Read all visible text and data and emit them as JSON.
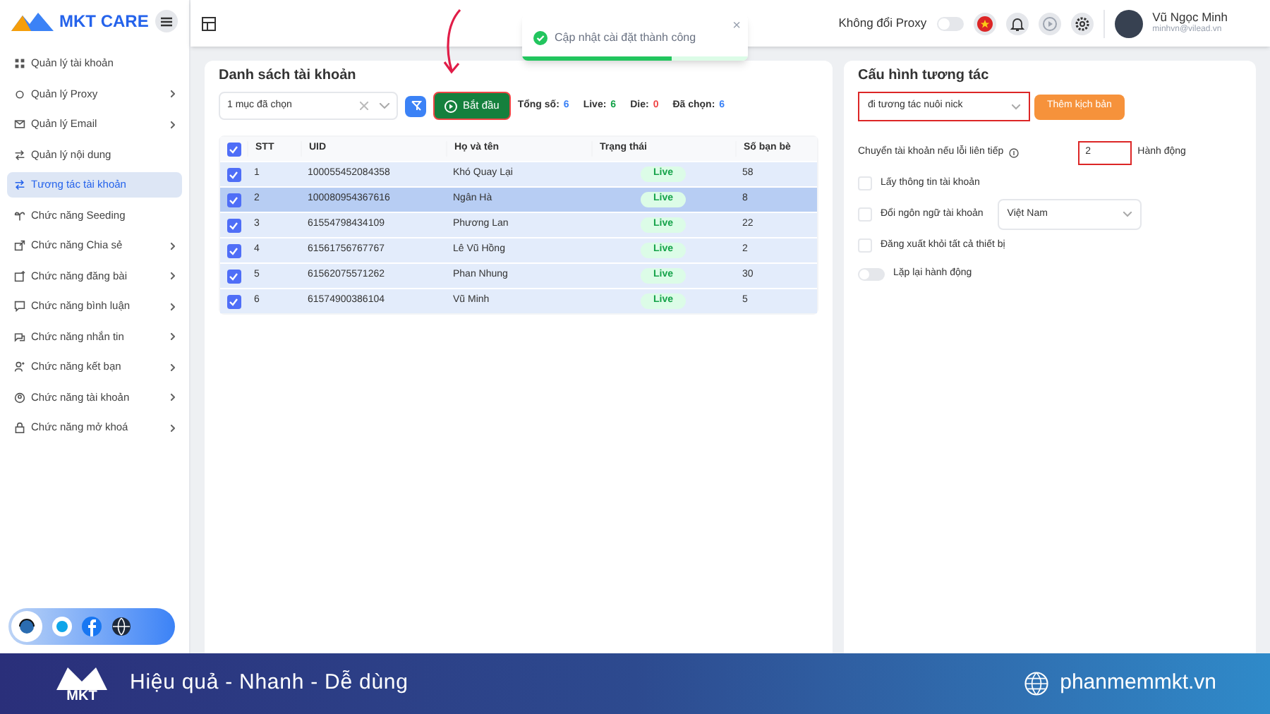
{
  "sidebar": {
    "logo": "MKT CARE",
    "items": [
      {
        "label": "Quản lý tài khoản",
        "selected": false,
        "expandable": false
      },
      {
        "label": "Quản lý Proxy",
        "selected": false,
        "expandable": true
      },
      {
        "label": "Quản lý Email",
        "selected": false,
        "expandable": true
      },
      {
        "label": "Quản lý nội dung",
        "selected": false,
        "expandable": false
      },
      {
        "label": "Tương tác tài khoản",
        "selected": true,
        "expandable": false
      },
      {
        "label": "Chức năng Seeding",
        "selected": false,
        "expandable": false
      },
      {
        "label": "Chức năng Chia sẻ",
        "selected": false,
        "expandable": true
      },
      {
        "label": "Chức năng đăng bài",
        "selected": false,
        "expandable": true
      },
      {
        "label": "Chức năng bình luận",
        "selected": false,
        "expandable": true
      },
      {
        "label": "Chức năng nhắn tin",
        "selected": false,
        "expandable": true
      },
      {
        "label": "Chức năng kết bạn",
        "selected": false,
        "expandable": true
      },
      {
        "label": "Chức năng tài khoản",
        "selected": false,
        "expandable": true
      },
      {
        "label": "Chức năng mở khoá",
        "selected": false,
        "expandable": true
      }
    ]
  },
  "topbar": {
    "proxy_label": "Không đổi Proxy",
    "proxy_on": false,
    "user_name": "Vũ Ngọc Minh",
    "user_email": "minhvn@vilead.vn"
  },
  "toast": {
    "message": "Cập nhật cài đặt thành công",
    "close": "×",
    "level": 0.66
  },
  "accounts": {
    "title": "Danh sách tài khoản",
    "filter_value": "1 mục đã chọn",
    "start_button": "Bắt đầu",
    "start_highlighted": true,
    "stats": [
      {
        "label": "Tổng số:",
        "value": "6",
        "color": "#3b82f6"
      },
      {
        "label": "Live:",
        "value": "6",
        "color": "#16a34a"
      },
      {
        "label": "Die:",
        "value": "0",
        "color": "#ef4444"
      },
      {
        "label": "Đã chọn:",
        "value": "6",
        "color": "#3b82f6"
      }
    ],
    "columns": [
      "STT",
      "UID",
      "Họ và tên",
      "Trạng thái",
      "Số bạn bè"
    ],
    "all_checked": true,
    "rows": [
      {
        "stt": "1",
        "uid": "100055452084358",
        "name": "Khó Quay Lại",
        "status": "Live",
        "friends": "58",
        "checked": true,
        "selected": false
      },
      {
        "stt": "2",
        "uid": "100080954367616",
        "name": "Ngân Hà",
        "status": "Live",
        "friends": "8",
        "checked": true,
        "selected": true
      },
      {
        "stt": "3",
        "uid": "61554798434109",
        "name": "Phương Lan",
        "status": "Live",
        "friends": "22",
        "checked": true,
        "selected": false
      },
      {
        "stt": "4",
        "uid": "61561756767767",
        "name": "Lê Vũ Hồng",
        "status": "Live",
        "friends": "2",
        "checked": true,
        "selected": false
      },
      {
        "stt": "5",
        "uid": "61562075571262",
        "name": "Phan Nhung",
        "status": "Live",
        "friends": "30",
        "checked": true,
        "selected": false
      },
      {
        "stt": "6",
        "uid": "61574900386104",
        "name": "Vũ Minh",
        "status": "Live",
        "friends": "5",
        "checked": true,
        "selected": false
      }
    ]
  },
  "config": {
    "title": "Cấu hình tương tác",
    "scenario": "đi tương tác nuôi nick",
    "scenario_highlighted": true,
    "add_button": "Thêm kịch bản",
    "switch_label": "Chuyển tài khoản nếu lỗi liên tiếp",
    "switch_value": "2",
    "switch_unit": "Hành động",
    "value_highlighted": true,
    "options": [
      {
        "kind": "checkbox",
        "label": "Lấy thông tin tài khoản",
        "checked": false
      },
      {
        "kind": "select",
        "label": "Đổi ngôn ngữ tài khoản",
        "checked": false,
        "value": "Việt Nam"
      },
      {
        "kind": "checkbox",
        "label": "Đăng xuất khỏi tất cả thiết bị",
        "checked": false
      },
      {
        "kind": "toggle",
        "label": "Lặp lại hành động",
        "checked": false
      }
    ]
  },
  "footer": {
    "slogan": "Hiệu quả - Nhanh - Dễ dùng",
    "website": "phanmemmkt.vn",
    "logo": "MKT"
  }
}
